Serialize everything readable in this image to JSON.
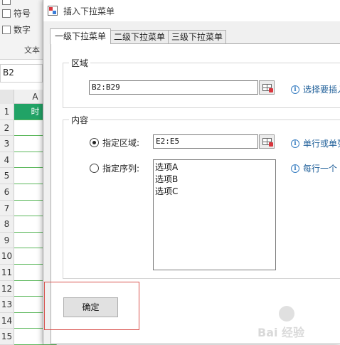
{
  "background": {
    "ribbon_items": [
      "",
      "符号",
      "数字"
    ],
    "ribbon_group": "文本",
    "name_box": "B2",
    "column_label": "A",
    "header_cell": "时",
    "row_numbers": [
      "1",
      "2",
      "3",
      "4",
      "5",
      "6",
      "7",
      "8",
      "9",
      "10",
      "11",
      "12",
      "13",
      "14",
      "15"
    ]
  },
  "dialog": {
    "title": "插入下拉菜单",
    "tabs": [
      "一级下拉菜单",
      "二级下拉菜单",
      "三级下拉菜单"
    ],
    "active_tab": "一级下拉菜单",
    "region": {
      "label": "区域",
      "value": "B2:B29",
      "hint": "选择要插入"
    },
    "content": {
      "label": "内容",
      "option_range": "指定区域:",
      "range_value": "E2:E5",
      "range_hint": "单行或单列",
      "option_sequence": "指定序列:",
      "sequence_items": [
        "选项A",
        "选项B",
        "选项C"
      ],
      "sequence_hint": "每行一个",
      "selected": "range"
    },
    "ok_label": "确定"
  },
  "watermark": "Bai 经验",
  "colors": {
    "excel_green": "#21a366",
    "highlight_red": "#d9534f",
    "hint_blue": "#1f5f99"
  }
}
